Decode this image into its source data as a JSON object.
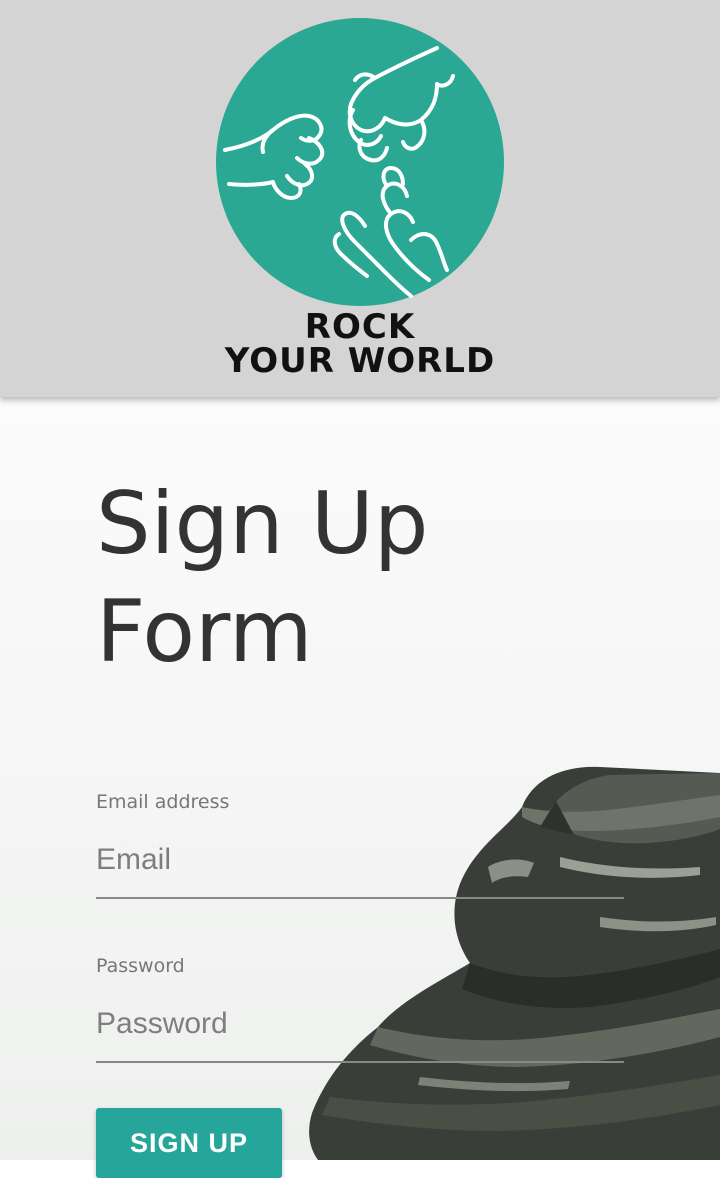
{
  "brand": {
    "logo_line1": "ROCK",
    "logo_line2": "YOUR WORLD",
    "logo_color": "#2aa894",
    "logo_icon": "hands-icon"
  },
  "page": {
    "title": "Sign Up Form"
  },
  "form": {
    "email_label": "Email address",
    "email_placeholder": "Email",
    "email_value": "",
    "password_label": "Password",
    "password_placeholder": "Password",
    "password_value": "",
    "submit_label": "SIGN UP",
    "accent_color": "#26a69a"
  },
  "background": {
    "image_icon": "rock-photo"
  }
}
